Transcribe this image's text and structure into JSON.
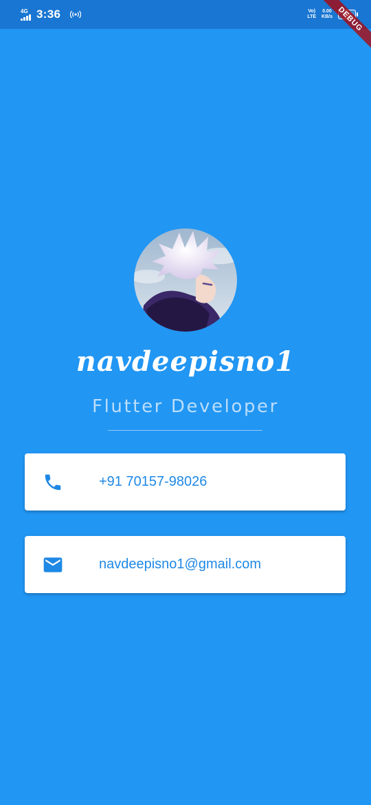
{
  "status_bar": {
    "network": "4G",
    "time": "3:36",
    "volte": "Vo)",
    "lte": "LTE",
    "speed_value": "0.00",
    "speed_unit": "KB/s",
    "battery": "62"
  },
  "debug_banner": "DEBUG",
  "profile": {
    "name": "navdeepisno1",
    "title": "Flutter Developer"
  },
  "contacts": {
    "phone": {
      "icon": "phone-icon",
      "value": "+91 70157-98026"
    },
    "email": {
      "icon": "mail-icon",
      "value": "navdeepisno1@gmail.com"
    }
  },
  "colors": {
    "background": "#2196F3",
    "status_bar": "#1976D2",
    "card": "#FFFFFF",
    "accent_text": "#1E88E5",
    "subtitle": "#BBDEFB"
  }
}
